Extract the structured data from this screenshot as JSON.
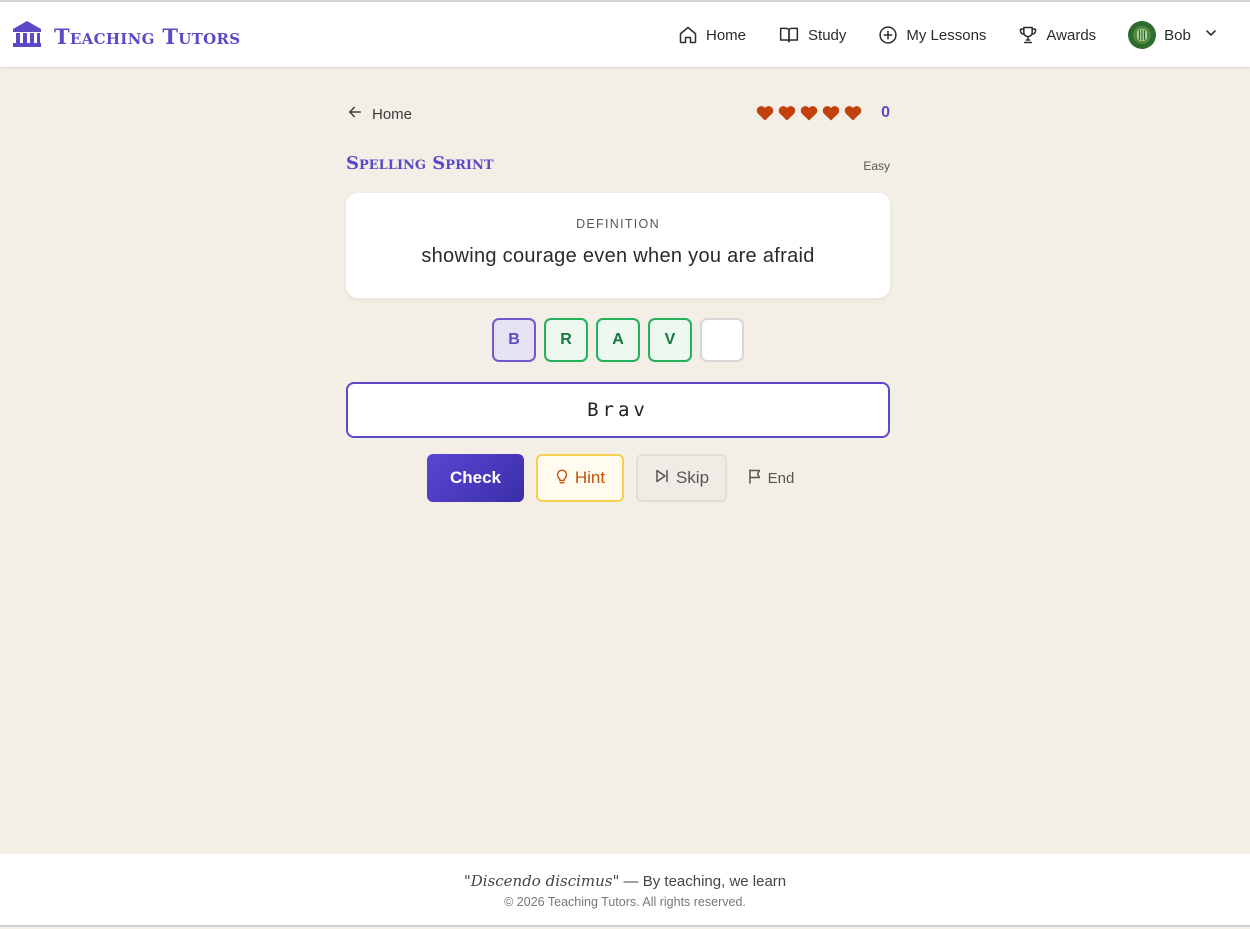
{
  "brand": {
    "name": "Teaching Tutors",
    "icon": "bank-icon",
    "color": "#5b49c7"
  },
  "nav": {
    "items": [
      {
        "label": "Home",
        "icon": "home-icon"
      },
      {
        "label": "Study",
        "icon": "book-open-icon"
      },
      {
        "label": "My Lessons",
        "icon": "plus-circle-icon"
      },
      {
        "label": "Awards",
        "icon": "trophy-icon"
      }
    ],
    "user": {
      "name": "Bob",
      "icon": "chevron-down-icon"
    }
  },
  "game": {
    "back_label": "Home",
    "lives": 5,
    "score": "0",
    "title": "Spelling Sprint",
    "difficulty": "Easy",
    "definition_label": "DEFINITION",
    "definition": "showing courage even when you are afraid",
    "tiles": [
      "B",
      "R",
      "A",
      "V",
      ""
    ],
    "answer_value": "Brav",
    "buttons": {
      "check": "Check",
      "hint": "Hint",
      "skip": "Skip",
      "end": "End"
    }
  },
  "colors": {
    "accent": "#5b49c7",
    "heart": "#c2410c",
    "tile_correct": "#22b35a",
    "background": "#f3efe6"
  },
  "footer": {
    "motto_latin": "\"Discendo discimus\"",
    "motto_rest": " — By teaching, we learn",
    "copyright": "© 2026 Teaching Tutors. All rights reserved."
  }
}
